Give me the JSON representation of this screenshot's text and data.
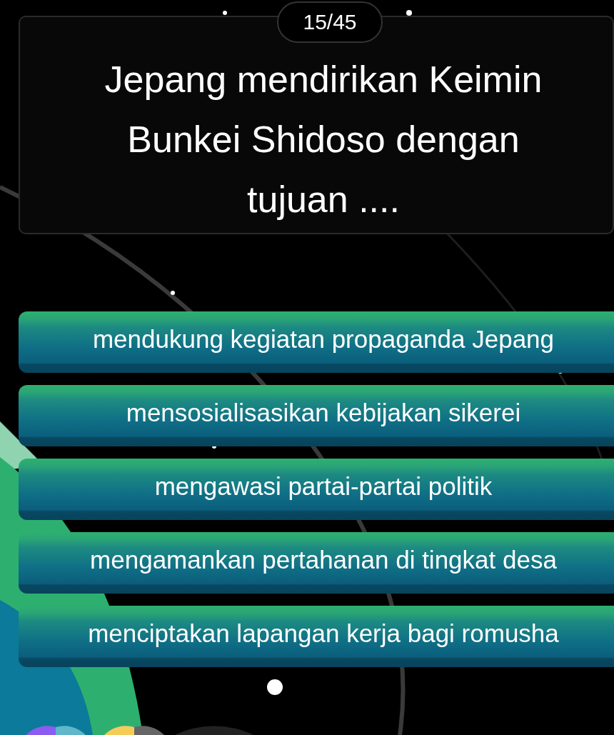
{
  "counter": "15/45",
  "question": "Jepang mendirikan Keimin Bunkei Shidoso dengan tujuan ....",
  "options": [
    {
      "label": "mendukung kegiatan propaganda Jepang"
    },
    {
      "label": "mensosialisasikan kebijakan sikerei"
    },
    {
      "label": "mengawasi partai-partai politik"
    },
    {
      "label": "mengamankan pertahanan di tingkat desa"
    },
    {
      "label": "menciptakan lapangan kerja bagi romusha"
    }
  ]
}
